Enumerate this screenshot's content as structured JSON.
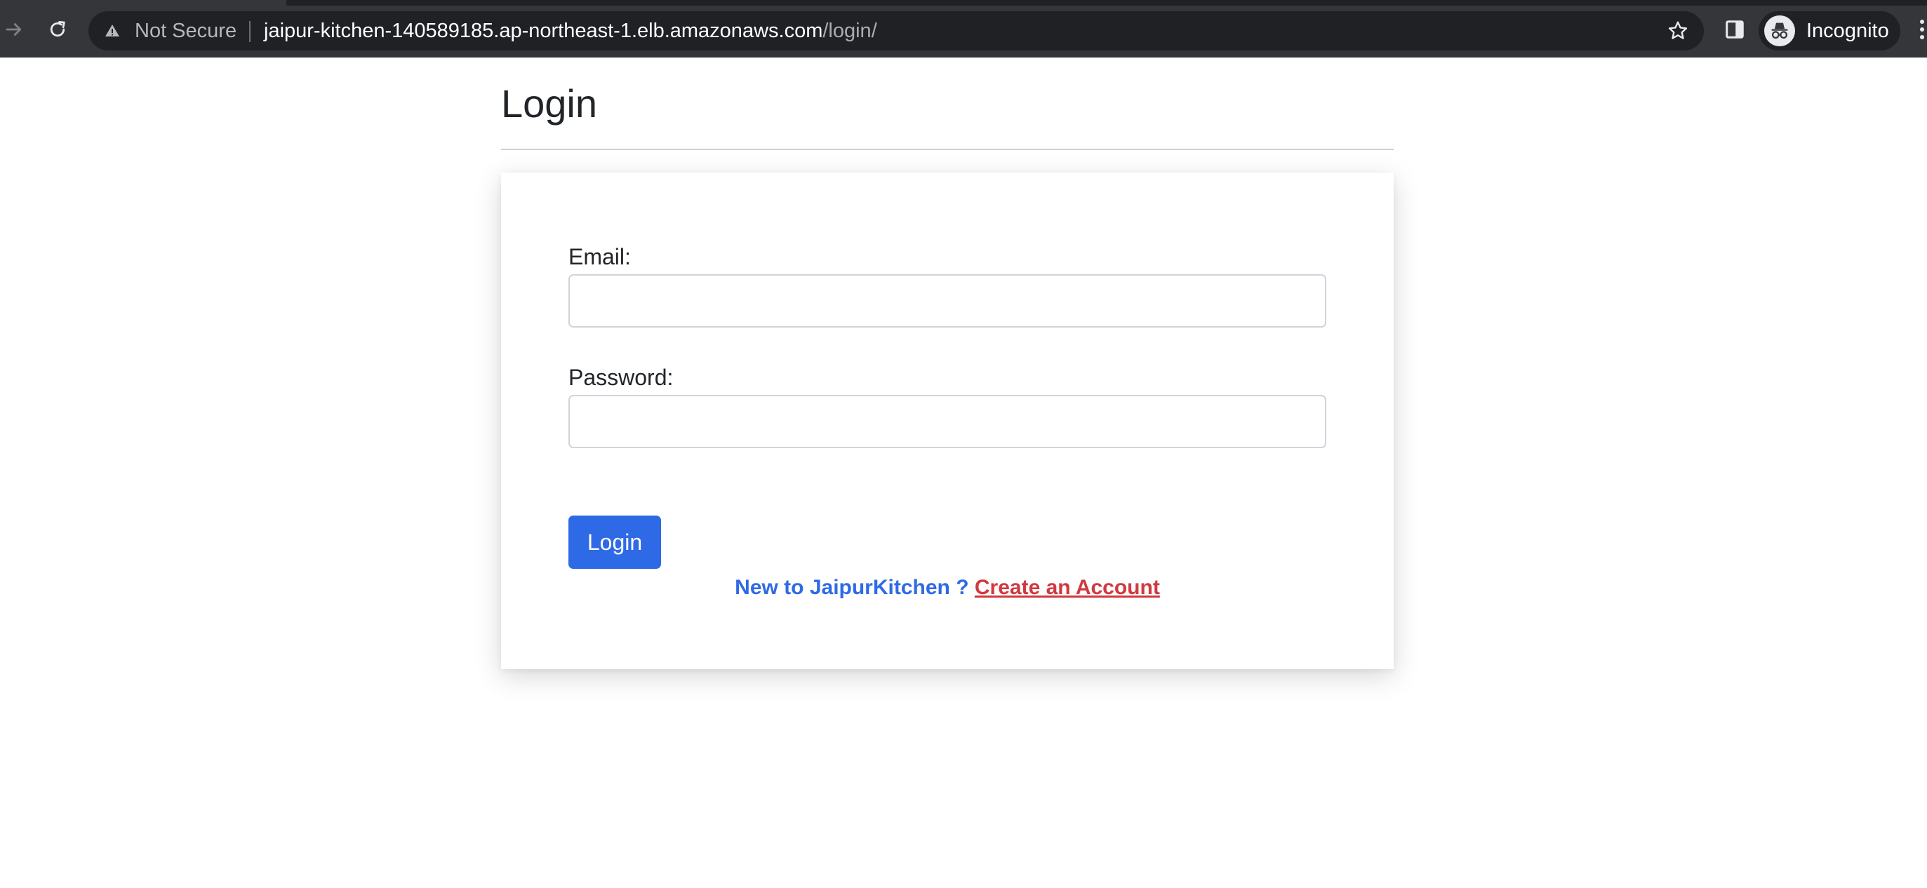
{
  "browser": {
    "security_label": "Not Secure",
    "url_host": "jaipur-kitchen-140589185.ap-northeast-1.elb.amazonaws.com",
    "url_path": "/login/",
    "profile_label": "Incognito",
    "icons": {
      "forward": "arrow-forward-icon",
      "reload": "reload-icon",
      "security": "warning-triangle-icon",
      "bookmark": "star-icon",
      "side_panel": "side-panel-icon",
      "profile": "incognito-icon",
      "menu": "kebab-menu-icon"
    },
    "colors": {
      "toolbar_bg": "#35363a",
      "omnibox_bg": "#202124"
    }
  },
  "page": {
    "title": "Login",
    "form": {
      "email_label": "Email:",
      "email_value": "",
      "password_label": "Password:",
      "password_value": "",
      "submit_label": "Login"
    },
    "signup": {
      "prompt": "New to JaipurKitchen ?",
      "link_label": "Create an Account"
    },
    "colors": {
      "primary": "#2f6ae6",
      "link_red": "#d0393e",
      "text": "#212529"
    }
  }
}
